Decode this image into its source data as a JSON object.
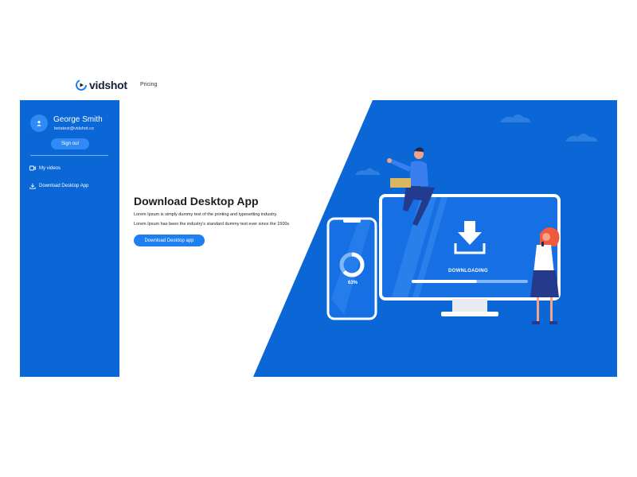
{
  "header": {
    "brand": "vidshot",
    "nav": {
      "pricing": "Pricing"
    }
  },
  "sidebar": {
    "user": {
      "name": "George Smith",
      "email": "betatest@vidshot.co"
    },
    "signout_label": "Sign out",
    "items": [
      {
        "label": "My videos",
        "icon": "video-icon"
      },
      {
        "label": "Download Desktop App",
        "icon": "download-icon"
      }
    ]
  },
  "main": {
    "title": "Download Desktop App",
    "description_lines": [
      "Lorem Ipsum is simply dummy text of the printing and typesetting industry.",
      "Lorem Ipsum has been the industry's standard dummy text ever since the 1500s"
    ],
    "download_button": "Download Desktop app",
    "illustration": {
      "phone_progress_text": "63%",
      "phone_progress_value": 0.63,
      "monitor_status": "DOWNLOADING",
      "monitor_progress_value": 0.56
    }
  },
  "colors": {
    "sidebar_bg": "#0b66d6",
    "hero_blue": "#0b66d6",
    "button_blue": "#1f7ff0",
    "brand_dark": "#1a1f36"
  }
}
